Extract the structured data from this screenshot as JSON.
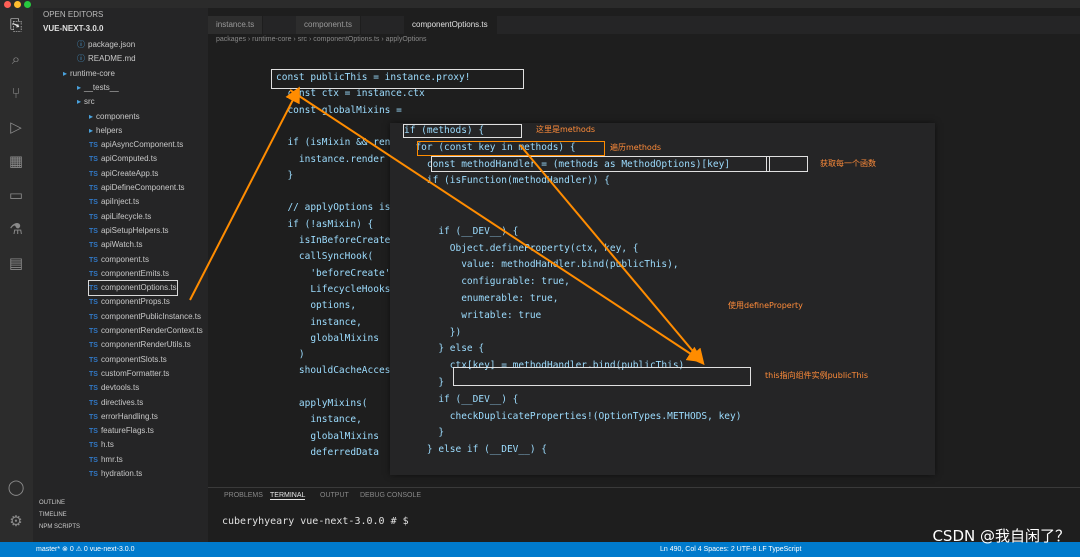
{
  "tabs": [
    {
      "label": "instance.ts",
      "active": false
    },
    {
      "label": "component.ts",
      "active": false
    },
    {
      "label": "componentOptions.ts",
      "active": true
    }
  ],
  "breadcrumb": "packages › runtime-core › src › componentOptions.ts › applyOptions",
  "sidebar": {
    "header": "OPEN EDITORS",
    "project": "VUE-NEXT-3.0.0",
    "items": [
      {
        "label": "package.json",
        "kind": "json"
      },
      {
        "label": "README.md",
        "kind": "md"
      },
      {
        "label": "runtime-core",
        "kind": "folder"
      },
      {
        "label": "__tests__",
        "kind": "folder"
      },
      {
        "label": "src",
        "kind": "folder"
      },
      {
        "label": "components",
        "kind": "folder"
      },
      {
        "label": "helpers",
        "kind": "folder"
      },
      {
        "label": "apiAsyncComponent.ts",
        "kind": "ts"
      },
      {
        "label": "apiComputed.ts",
        "kind": "ts"
      },
      {
        "label": "apiCreateApp.ts",
        "kind": "ts"
      },
      {
        "label": "apiDefineComponent.ts",
        "kind": "ts"
      },
      {
        "label": "apiInject.ts",
        "kind": "ts"
      },
      {
        "label": "apiLifecycle.ts",
        "kind": "ts"
      },
      {
        "label": "apiSetupHelpers.ts",
        "kind": "ts"
      },
      {
        "label": "apiWatch.ts",
        "kind": "ts"
      },
      {
        "label": "component.ts",
        "kind": "ts"
      },
      {
        "label": "componentEmits.ts",
        "kind": "ts"
      },
      {
        "label": "componentOptions.ts",
        "kind": "ts",
        "selected": true
      },
      {
        "label": "componentProps.ts",
        "kind": "ts"
      },
      {
        "label": "componentPublicInstance.ts",
        "kind": "ts"
      },
      {
        "label": "componentRenderContext.ts",
        "kind": "ts"
      },
      {
        "label": "componentRenderUtils.ts",
        "kind": "ts"
      },
      {
        "label": "componentSlots.ts",
        "kind": "ts"
      },
      {
        "label": "customFormatter.ts",
        "kind": "ts"
      },
      {
        "label": "devtools.ts",
        "kind": "ts"
      },
      {
        "label": "directives.ts",
        "kind": "ts"
      },
      {
        "label": "errorHandling.ts",
        "kind": "ts"
      },
      {
        "label": "featureFlags.ts",
        "kind": "ts"
      },
      {
        "label": "h.ts",
        "kind": "ts"
      },
      {
        "label": "hmr.ts",
        "kind": "ts"
      },
      {
        "label": "hydration.ts",
        "kind": "ts"
      }
    ],
    "outline": "OUTLINE",
    "timeline": "TIMELINE",
    "npm_scripts": "NPM SCRIPTS"
  },
  "code_main": [
    {
      "n": "",
      "t": "const publicThis = instance.proxy!"
    },
    {
      "n": "",
      "t": "  const ctx = instance.ctx"
    },
    {
      "n": "",
      "t": "  const globalMixins = "
    },
    {
      "n": "",
      "t": ""
    },
    {
      "n": "",
      "t": "  if (isMixin && render"
    },
    {
      "n": "",
      "t": "    instance.render ="
    },
    {
      "n": "",
      "t": "  }"
    },
    {
      "n": "",
      "t": ""
    },
    {
      "n": "",
      "t": "  // applyOptions is c"
    },
    {
      "n": "",
      "t": "  if (!asMixin) {"
    },
    {
      "n": "",
      "t": "    isInBeforeCreate"
    },
    {
      "n": "",
      "t": "    callSyncHook("
    },
    {
      "n": "",
      "t": "      'beforeCreate',"
    },
    {
      "n": "",
      "t": "      LifecycleHooks"
    },
    {
      "n": "",
      "t": "      options,"
    },
    {
      "n": "",
      "t": "      instance,"
    },
    {
      "n": "",
      "t": "      globalMixins"
    },
    {
      "n": "",
      "t": "    )"
    },
    {
      "n": "",
      "t": "    shouldCacheAccess"
    },
    {
      "n": "",
      "t": ""
    },
    {
      "n": "",
      "t": "    applyMixins("
    },
    {
      "n": "",
      "t": "      instance,"
    },
    {
      "n": "",
      "t": "      globalMixins"
    },
    {
      "n": "",
      "t": "      deferredData"
    }
  ],
  "code_popup": [
    "if (methods) {",
    "  for (const key in methods) {",
    "    const methodHandler = (methods as MethodOptions)[key]",
    "    if (isFunction(methodHandler)) {",
    "",
    "",
    "      if (__DEV__) {",
    "        Object.defineProperty(ctx, key, {",
    "          value: methodHandler.bind(publicThis),",
    "          configurable: true,",
    "          enumerable: true,",
    "          writable: true",
    "        })",
    "      } else {",
    "        ctx[key] = methodHandler.bind(publicThis)",
    "      }",
    "      if (__DEV__) {",
    "        checkDuplicateProperties!(OptionTypes.METHODS, key)",
    "      }",
    "    } else if (__DEV__) {"
  ],
  "annotations": {
    "methods_note": "这里是methods",
    "loop_note": "遍历methods",
    "key_note": "获取每一个函数",
    "bind_note": "this指向组件实例publicThis",
    "define_note": "使用defineProperty"
  },
  "panel": {
    "tabs": [
      "PROBLEMS",
      "TERMINAL",
      "OUTPUT",
      "DEBUG CONSOLE"
    ],
    "active_index": 1,
    "terminal_line": "cuberyhyeary vue-next-3.0.0 # $"
  },
  "statusbar": {
    "left": "master*  ⊗ 0 ⚠ 0   vue-next-3.0.0",
    "right": "Ln 490, Col 4   Spaces: 2   UTF-8   LF   TypeScript"
  },
  "watermark": "CSDN @我自闲了？",
  "colors": {
    "annotation": "#ff8c3a",
    "box_white": "#e0e0e0",
    "box_orange": "#ff8c00",
    "status": "#007acc"
  }
}
